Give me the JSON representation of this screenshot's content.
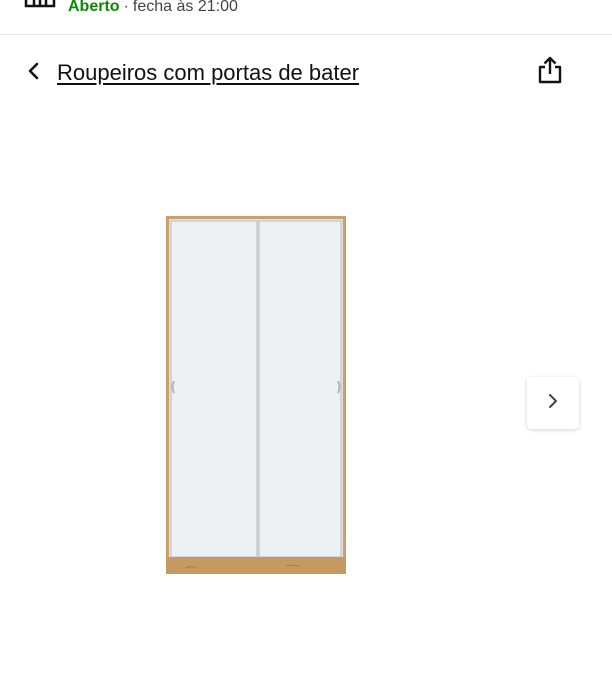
{
  "store": {
    "status_open": "Aberto",
    "separator": "·",
    "closing_text": "fecha às 21:00",
    "icon": "store-icon"
  },
  "header": {
    "back_icon": "chevron-left-icon",
    "breadcrumb_label": "Roupeiros com portas de bater",
    "share_icon": "share-icon"
  },
  "gallery": {
    "image_alt": "product-wardrobe-image",
    "next_icon": "chevron-right-icon"
  },
  "colors": {
    "status_open": "#0a8a00",
    "wood": "#c9a06a",
    "door": "#eef1f3"
  }
}
